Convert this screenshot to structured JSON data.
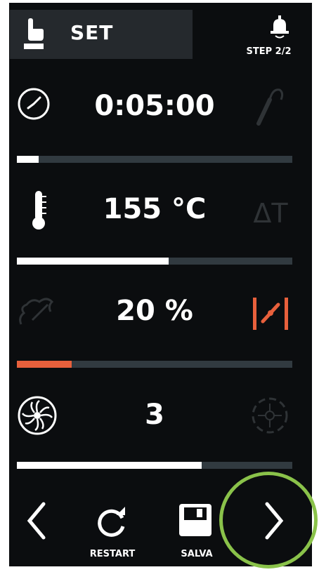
{
  "header": {
    "title": "SET",
    "step": "STEP 2/2"
  },
  "rows": [
    {
      "value": "0:05:00",
      "left_icon": "clock-icon",
      "right_icon": "probe-icon",
      "progress": 0.08,
      "fill_color": "#ffffff"
    },
    {
      "value": "155 °C",
      "left_icon": "thermometer-icon",
      "right_icon": "delta-t-icon",
      "right_text": "ΔT",
      "progress": 0.55,
      "fill_color": "#ffffff"
    },
    {
      "value": "20 %",
      "left_icon": "steam-icon",
      "right_icon": "vent-valve-icon",
      "progress": 0.2,
      "fill_color": "#e8603c"
    },
    {
      "value": "3",
      "left_icon": "fan-icon",
      "right_icon": "fan-reverse-icon",
      "progress": 0.67,
      "fill_color": "#ffffff"
    }
  ],
  "nav": {
    "restart_label": "RESTART",
    "save_label": "SALVA"
  },
  "colors": {
    "accent": "#e8603c",
    "track": "#313a40",
    "highlight": "#8ac24a"
  }
}
